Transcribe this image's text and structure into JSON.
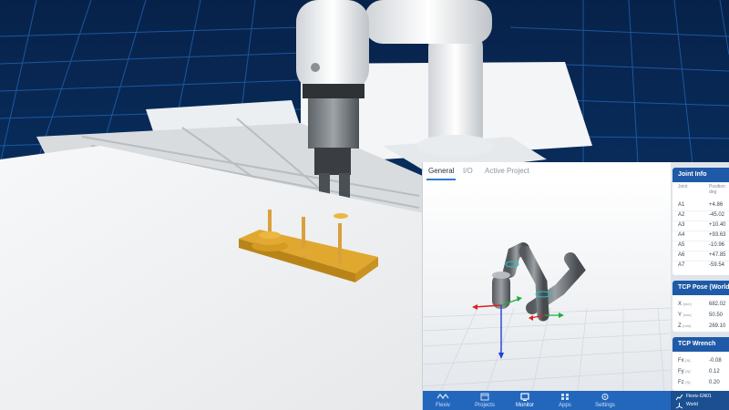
{
  "tabs": [
    "General",
    "I/O",
    "Active Project"
  ],
  "active_tab": 0,
  "joint_info": {
    "title": "Joint Info",
    "col_joint": "Joint",
    "col_position": "Position",
    "col_position_unit": "deg",
    "rows": [
      {
        "joint": "A1",
        "value": "+4.86"
      },
      {
        "joint": "A2",
        "value": "-45.02"
      },
      {
        "joint": "A3",
        "value": "+10.40"
      },
      {
        "joint": "A4",
        "value": "+93.63"
      },
      {
        "joint": "A5",
        "value": "-10.96"
      },
      {
        "joint": "A6",
        "value": "+47.85"
      },
      {
        "joint": "A7",
        "value": "-59.54"
      }
    ]
  },
  "tcp_pose": {
    "title": "TCP Pose (World Coordinates)",
    "rows": [
      {
        "axis": "X",
        "unit": "[mm]",
        "value": "682.02"
      },
      {
        "axis": "Y",
        "unit": "[mm]",
        "value": "50.50"
      },
      {
        "axis": "Z",
        "unit": "[mm]",
        "value": "269.10"
      }
    ]
  },
  "tcp_wrench": {
    "title": "TCP Wrench",
    "rows": [
      {
        "axis": "Fx",
        "unit": "[N]",
        "value": "-0.08"
      },
      {
        "axis": "Fy",
        "unit": "[N]",
        "value": "0.12"
      },
      {
        "axis": "Fz",
        "unit": "[N]",
        "value": "0.20"
      }
    ]
  },
  "nav": [
    {
      "label": "Flexiv",
      "icon": "flexiv-logo-icon"
    },
    {
      "label": "Projects",
      "icon": "projects-icon"
    },
    {
      "label": "Monitor",
      "icon": "monitor-icon"
    },
    {
      "label": "Apps",
      "icon": "apps-icon"
    },
    {
      "label": "Settings",
      "icon": "settings-icon"
    }
  ],
  "active_nav": 2,
  "status": {
    "robot": "Flexiv-GN01",
    "frame": "World"
  },
  "colors": {
    "accent": "#2e7bd6",
    "nav_bar": "#2367bd",
    "card_header": "#1f5aa8",
    "axis_x": "#e02020",
    "axis_y": "#1fae3a",
    "axis_z": "#1f3fd6",
    "peg_board": "#e0a82e"
  }
}
